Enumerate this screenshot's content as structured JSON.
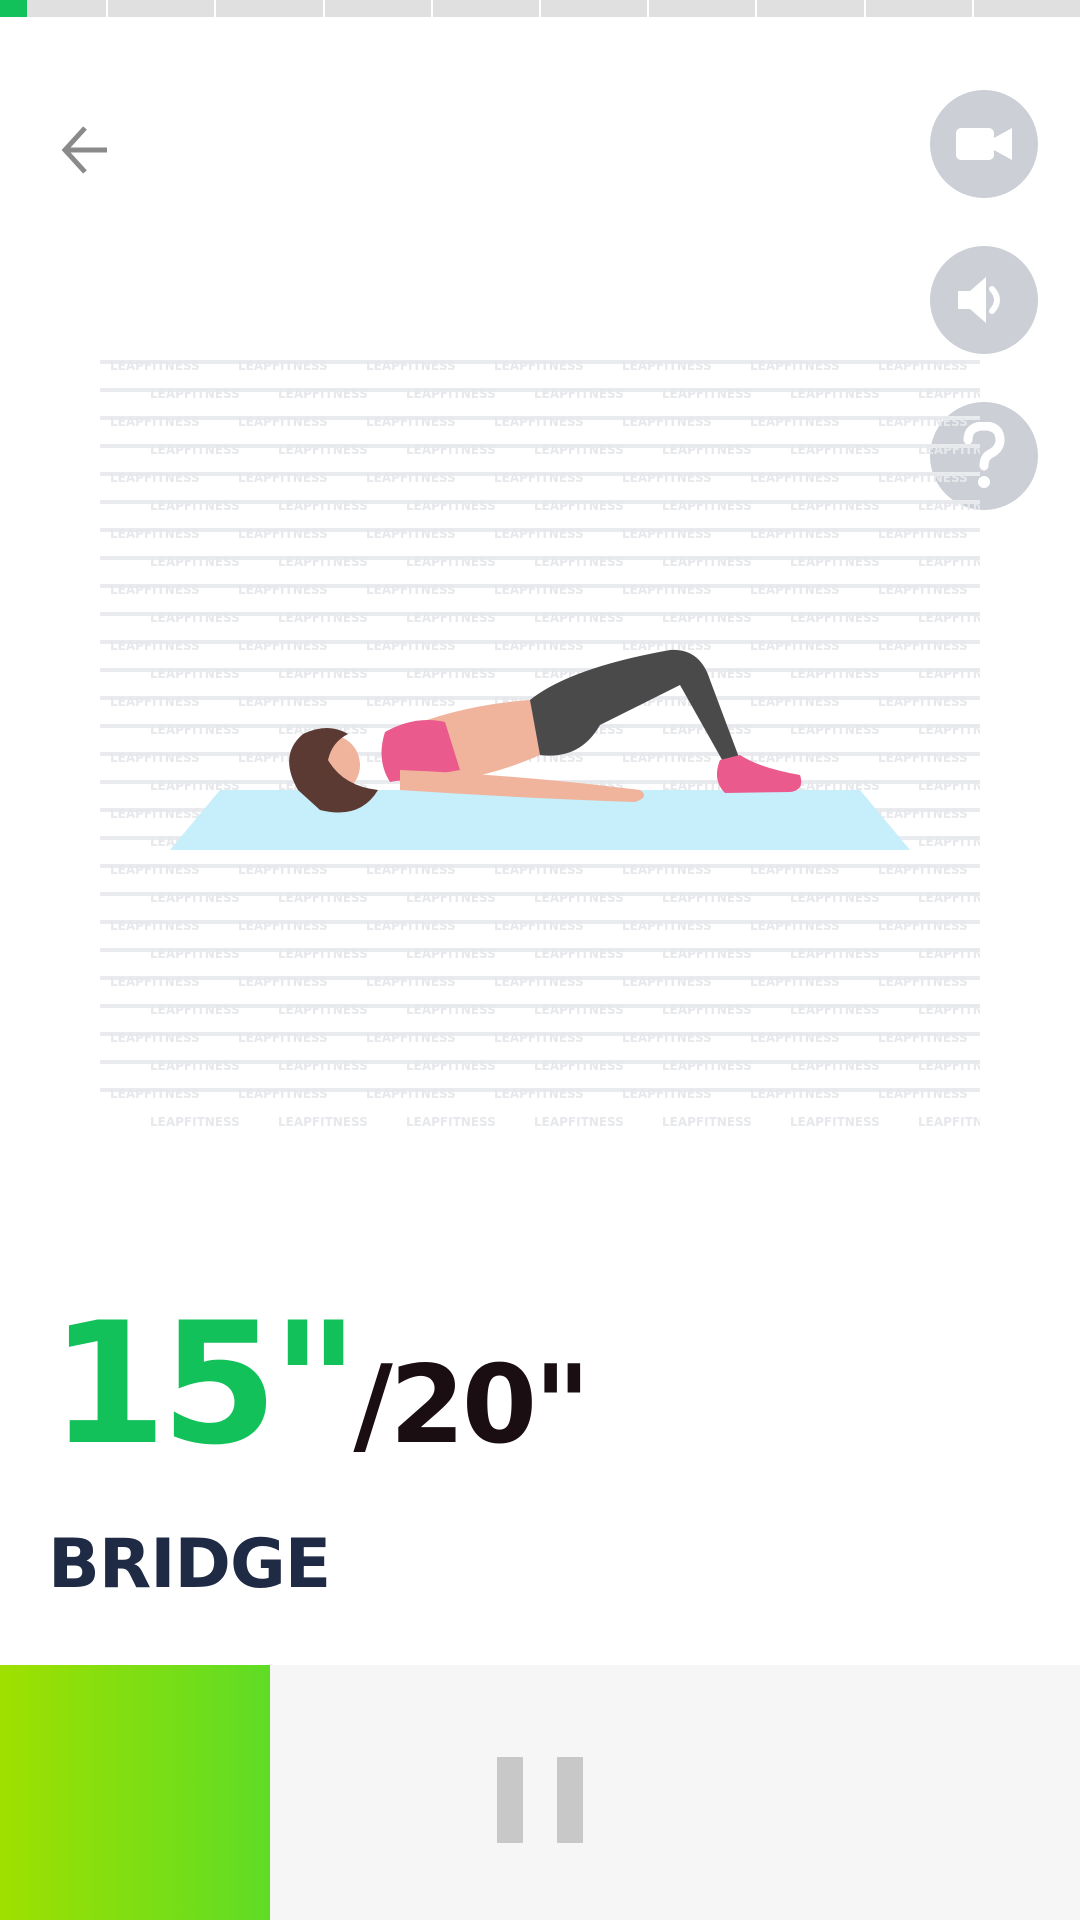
{
  "progress": {
    "segments": 10,
    "current_segment": 0,
    "current_segment_fraction": 0.25
  },
  "header": {
    "back_icon": "arrow-left-icon",
    "video_icon": "video-camera-icon",
    "sound_icon": "speaker-icon",
    "help_icon": "question-mark-icon",
    "button_bg": "#ccd0d6"
  },
  "illustration": {
    "subject": "bridge exercise",
    "watermark": "LEAPFITNESS"
  },
  "timer": {
    "current": "15\"",
    "total": "/20\""
  },
  "exercise": {
    "name": "BRIDGE"
  },
  "controls": {
    "pause_icon": "pause-icon",
    "elapsed_fraction": 0.25,
    "accent_start": "#9fe000",
    "accent_end": "#5fdc25"
  },
  "colors": {
    "accent": "#12c15a",
    "title": "#1f2a44"
  }
}
